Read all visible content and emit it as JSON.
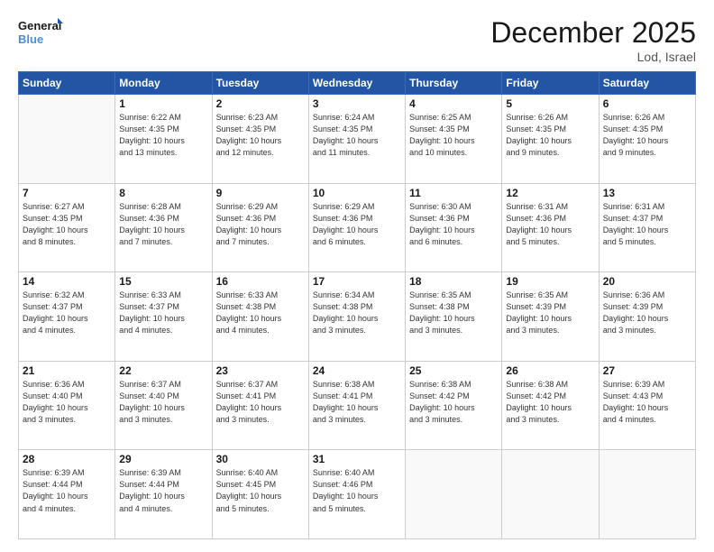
{
  "header": {
    "logo_general": "General",
    "logo_blue": "Blue",
    "month_title": "December 2025",
    "location": "Lod, Israel"
  },
  "days_of_week": [
    "Sunday",
    "Monday",
    "Tuesday",
    "Wednesday",
    "Thursday",
    "Friday",
    "Saturday"
  ],
  "weeks": [
    [
      {
        "day": "",
        "info": ""
      },
      {
        "day": "1",
        "info": "Sunrise: 6:22 AM\nSunset: 4:35 PM\nDaylight: 10 hours\nand 13 minutes."
      },
      {
        "day": "2",
        "info": "Sunrise: 6:23 AM\nSunset: 4:35 PM\nDaylight: 10 hours\nand 12 minutes."
      },
      {
        "day": "3",
        "info": "Sunrise: 6:24 AM\nSunset: 4:35 PM\nDaylight: 10 hours\nand 11 minutes."
      },
      {
        "day": "4",
        "info": "Sunrise: 6:25 AM\nSunset: 4:35 PM\nDaylight: 10 hours\nand 10 minutes."
      },
      {
        "day": "5",
        "info": "Sunrise: 6:26 AM\nSunset: 4:35 PM\nDaylight: 10 hours\nand 9 minutes."
      },
      {
        "day": "6",
        "info": "Sunrise: 6:26 AM\nSunset: 4:35 PM\nDaylight: 10 hours\nand 9 minutes."
      }
    ],
    [
      {
        "day": "7",
        "info": "Sunrise: 6:27 AM\nSunset: 4:35 PM\nDaylight: 10 hours\nand 8 minutes."
      },
      {
        "day": "8",
        "info": "Sunrise: 6:28 AM\nSunset: 4:36 PM\nDaylight: 10 hours\nand 7 minutes."
      },
      {
        "day": "9",
        "info": "Sunrise: 6:29 AM\nSunset: 4:36 PM\nDaylight: 10 hours\nand 7 minutes."
      },
      {
        "day": "10",
        "info": "Sunrise: 6:29 AM\nSunset: 4:36 PM\nDaylight: 10 hours\nand 6 minutes."
      },
      {
        "day": "11",
        "info": "Sunrise: 6:30 AM\nSunset: 4:36 PM\nDaylight: 10 hours\nand 6 minutes."
      },
      {
        "day": "12",
        "info": "Sunrise: 6:31 AM\nSunset: 4:36 PM\nDaylight: 10 hours\nand 5 minutes."
      },
      {
        "day": "13",
        "info": "Sunrise: 6:31 AM\nSunset: 4:37 PM\nDaylight: 10 hours\nand 5 minutes."
      }
    ],
    [
      {
        "day": "14",
        "info": "Sunrise: 6:32 AM\nSunset: 4:37 PM\nDaylight: 10 hours\nand 4 minutes."
      },
      {
        "day": "15",
        "info": "Sunrise: 6:33 AM\nSunset: 4:37 PM\nDaylight: 10 hours\nand 4 minutes."
      },
      {
        "day": "16",
        "info": "Sunrise: 6:33 AM\nSunset: 4:38 PM\nDaylight: 10 hours\nand 4 minutes."
      },
      {
        "day": "17",
        "info": "Sunrise: 6:34 AM\nSunset: 4:38 PM\nDaylight: 10 hours\nand 3 minutes."
      },
      {
        "day": "18",
        "info": "Sunrise: 6:35 AM\nSunset: 4:38 PM\nDaylight: 10 hours\nand 3 minutes."
      },
      {
        "day": "19",
        "info": "Sunrise: 6:35 AM\nSunset: 4:39 PM\nDaylight: 10 hours\nand 3 minutes."
      },
      {
        "day": "20",
        "info": "Sunrise: 6:36 AM\nSunset: 4:39 PM\nDaylight: 10 hours\nand 3 minutes."
      }
    ],
    [
      {
        "day": "21",
        "info": "Sunrise: 6:36 AM\nSunset: 4:40 PM\nDaylight: 10 hours\nand 3 minutes."
      },
      {
        "day": "22",
        "info": "Sunrise: 6:37 AM\nSunset: 4:40 PM\nDaylight: 10 hours\nand 3 minutes."
      },
      {
        "day": "23",
        "info": "Sunrise: 6:37 AM\nSunset: 4:41 PM\nDaylight: 10 hours\nand 3 minutes."
      },
      {
        "day": "24",
        "info": "Sunrise: 6:38 AM\nSunset: 4:41 PM\nDaylight: 10 hours\nand 3 minutes."
      },
      {
        "day": "25",
        "info": "Sunrise: 6:38 AM\nSunset: 4:42 PM\nDaylight: 10 hours\nand 3 minutes."
      },
      {
        "day": "26",
        "info": "Sunrise: 6:38 AM\nSunset: 4:42 PM\nDaylight: 10 hours\nand 3 minutes."
      },
      {
        "day": "27",
        "info": "Sunrise: 6:39 AM\nSunset: 4:43 PM\nDaylight: 10 hours\nand 4 minutes."
      }
    ],
    [
      {
        "day": "28",
        "info": "Sunrise: 6:39 AM\nSunset: 4:44 PM\nDaylight: 10 hours\nand 4 minutes."
      },
      {
        "day": "29",
        "info": "Sunrise: 6:39 AM\nSunset: 4:44 PM\nDaylight: 10 hours\nand 4 minutes."
      },
      {
        "day": "30",
        "info": "Sunrise: 6:40 AM\nSunset: 4:45 PM\nDaylight: 10 hours\nand 5 minutes."
      },
      {
        "day": "31",
        "info": "Sunrise: 6:40 AM\nSunset: 4:46 PM\nDaylight: 10 hours\nand 5 minutes."
      },
      {
        "day": "",
        "info": ""
      },
      {
        "day": "",
        "info": ""
      },
      {
        "day": "",
        "info": ""
      }
    ]
  ]
}
